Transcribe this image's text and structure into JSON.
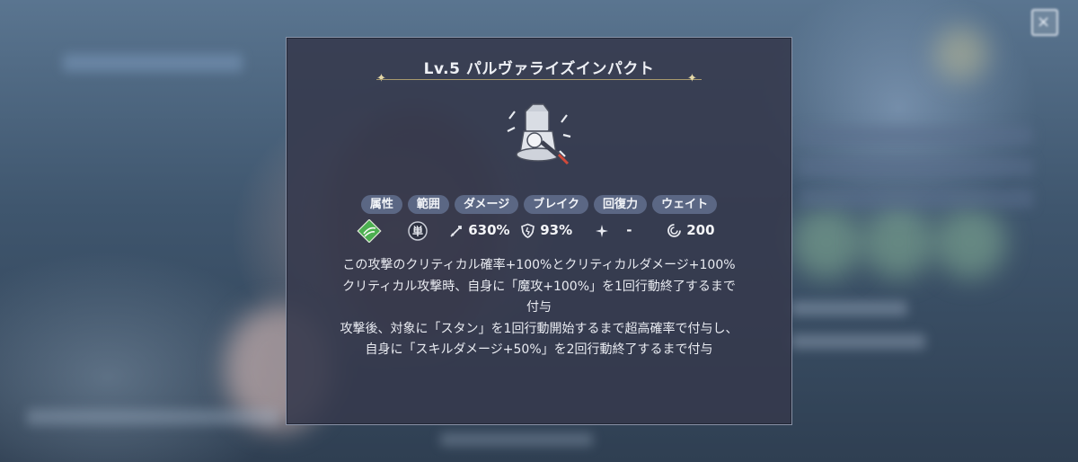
{
  "skill": {
    "title": "Lv.5 パルヴァライズインパクト",
    "icon": "hammer-skill-icon"
  },
  "stats": {
    "labels": [
      "属性",
      "範囲",
      "ダメージ",
      "ブレイク",
      "回復力",
      "ウェイト"
    ],
    "element_icon": "wind-element-icon",
    "range_badge": "単",
    "damage": "630%",
    "break": "93%",
    "heal": "-",
    "wait": "200"
  },
  "description": [
    "この攻撃のクリティカル確率+100%とクリティカルダメージ+100%",
    "クリティカル攻撃時、自身に「魔攻+100%」を1回行動終了するまで",
    "付与",
    "攻撃後、対象に「スタン」を1回行動開始するまで超高確率で付与し、",
    "自身に「スキルダメージ+50%」を2回行動終了するまで付与"
  ],
  "colors": {
    "panel_bg": "#35394c",
    "tag_bg": "#5b6784",
    "accent_gold": "#e6d9a8",
    "element_green": "#4caf50"
  }
}
